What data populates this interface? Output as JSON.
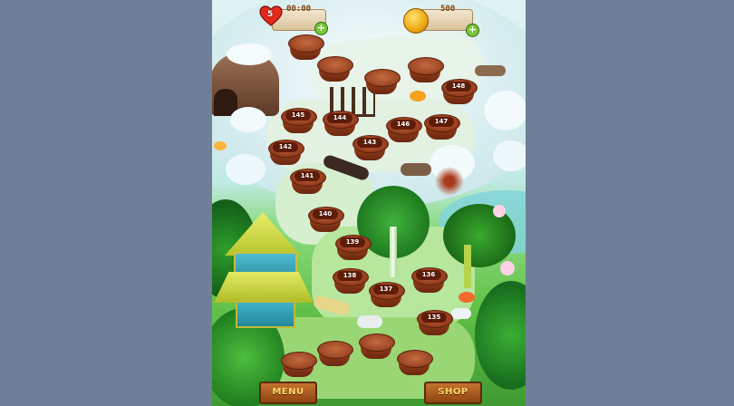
{
  "hud": {
    "lives": "5",
    "timer": "00:00",
    "coins": "500",
    "add_label": "+"
  },
  "levels": [
    {
      "label": "148"
    },
    {
      "label": "145"
    },
    {
      "label": "144"
    },
    {
      "label": "146"
    },
    {
      "label": "147"
    },
    {
      "label": "143"
    },
    {
      "label": "142"
    },
    {
      "label": "141"
    },
    {
      "label": "140"
    },
    {
      "label": "139"
    },
    {
      "label": "138"
    },
    {
      "label": "137"
    },
    {
      "label": "136"
    },
    {
      "label": "135"
    }
  ],
  "buttons": {
    "menu_label": "MENU",
    "shop_label": "SHOP"
  },
  "colors": {
    "background": "#6f7f98",
    "stump": "#9e4322",
    "button": "#c4722d",
    "button_text": "#ffd86b"
  }
}
